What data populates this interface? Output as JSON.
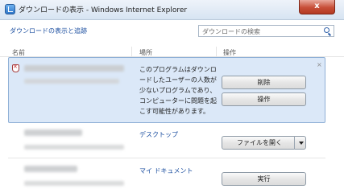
{
  "window": {
    "title": "ダウンロードの表示 - Windows Internet Explorer",
    "close_label": "x"
  },
  "header": {
    "link": "ダウンロードの表示と追跡",
    "search_placeholder": "ダウンロードの検索"
  },
  "columns": [
    "名前",
    "場所",
    "操作"
  ],
  "downloads": [
    {
      "warning": "このプログラムはダウンロードしたユーザーの人数が少ないプログラムであり、コンピューターに問題を起こす可能性があります。",
      "actions": [
        "削除",
        "操作"
      ],
      "dismiss": "×"
    },
    {
      "location": "デスクトップ",
      "action": "ファイルを開く"
    },
    {
      "location": "マイ ドキュメント",
      "action": "実行"
    }
  ]
}
